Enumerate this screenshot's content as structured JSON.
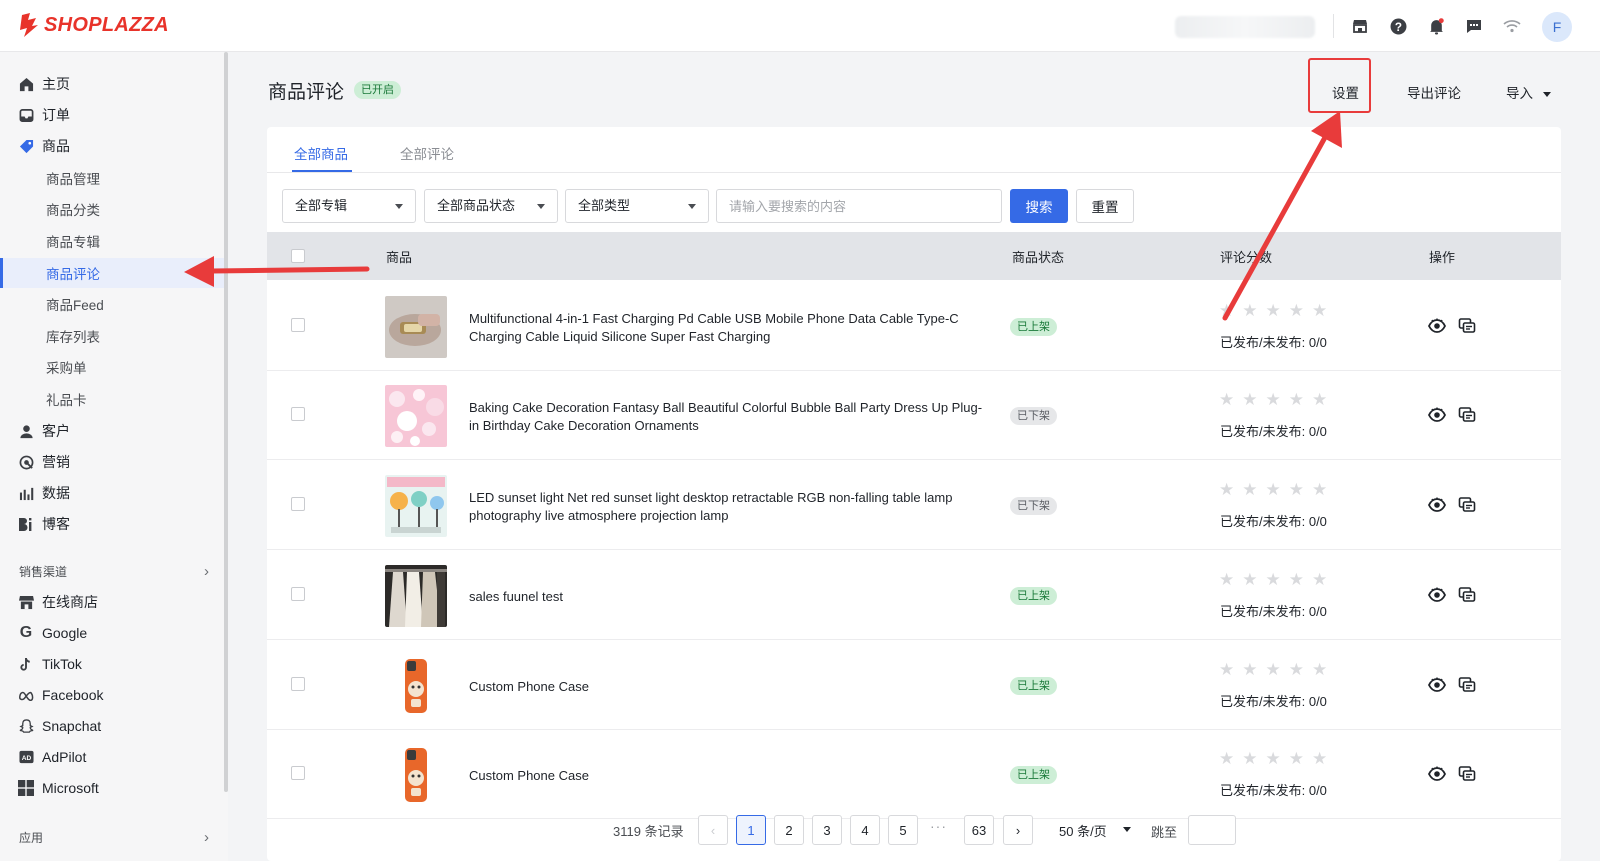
{
  "app": {
    "brand": "SHOPLAZZA",
    "user_initial": "F",
    "accent_color": "#356ae6",
    "annotation_color": "#e83b3b"
  },
  "topbar_icons": [
    "store-icon",
    "help-icon",
    "bell-icon",
    "message-icon",
    "wifi-icon"
  ],
  "sidebar": {
    "items": [
      {
        "label": "主页",
        "icon": "home-icon"
      },
      {
        "label": "订单",
        "icon": "inbox-icon"
      },
      {
        "label": "商品",
        "icon": "tag-icon"
      }
    ],
    "sub_items": [
      {
        "label": "商品管理"
      },
      {
        "label": "商品分类"
      },
      {
        "label": "商品专辑"
      },
      {
        "label": "商品评论",
        "active": true
      },
      {
        "label": "商品Feed"
      },
      {
        "label": "库存列表"
      },
      {
        "label": "采购单"
      },
      {
        "label": "礼品卡"
      }
    ],
    "items_after": [
      {
        "label": "客户",
        "icon": "user-icon"
      },
      {
        "label": "营销",
        "icon": "marketing-icon"
      },
      {
        "label": "数据",
        "icon": "chart-icon"
      },
      {
        "label": "博客",
        "icon": "blog-icon"
      }
    ],
    "sales_channels_title": "销售渠道",
    "channels": [
      {
        "label": "在线商店",
        "icon": "store-icon"
      },
      {
        "label": "Google",
        "icon": "google-icon"
      },
      {
        "label": "TikTok",
        "icon": "tiktok-icon"
      },
      {
        "label": "Facebook",
        "icon": "meta-icon"
      },
      {
        "label": "Snapchat",
        "icon": "snapchat-icon"
      },
      {
        "label": "AdPilot",
        "icon": "adpilot-icon"
      },
      {
        "label": "Microsoft",
        "icon": "microsoft-icon"
      }
    ],
    "apps_title": "应用"
  },
  "header": {
    "title": "商品评论",
    "badge": "已开启",
    "settings": "设置",
    "export": "导出评论",
    "import": "导入"
  },
  "tabs": [
    {
      "label": "全部商品",
      "active": true
    },
    {
      "label": "全部评论",
      "active": false
    }
  ],
  "filters": {
    "album": "全部专辑",
    "status": "全部商品状态",
    "type": "全部类型",
    "search_placeholder": "请输入要搜索的内容",
    "search_button": "搜索",
    "reset_button": "重置"
  },
  "table": {
    "columns": [
      "商品",
      "商品状态",
      "评论分数",
      "操作"
    ],
    "rows": [
      {
        "name": "Multifunctional 4-in-1 Fast Charging Pd Cable USB Mobile Phone Data Cable Type-C Charging Cable Liquid Silicone Super Fast Charging",
        "status": "已上架",
        "status_on": true,
        "published": "已发布/未发布: 0/0",
        "thumb": "cable"
      },
      {
        "name": "Baking Cake Decoration Fantasy Ball Beautiful Colorful Bubble Ball Party Dress Up Plug-in Birthday Cake Decoration Ornaments",
        "status": "已下架",
        "status_on": false,
        "published": "已发布/未发布: 0/0",
        "thumb": "pearls"
      },
      {
        "name": "LED sunset light Net red sunset light desktop retractable RGB non-falling table lamp photography live atmosphere projection lamp",
        "status": "已下架",
        "status_on": false,
        "published": "已发布/未发布: 0/0",
        "thumb": "lamp"
      },
      {
        "name": "sales fuunel test",
        "status": "已上架",
        "status_on": true,
        "published": "已发布/未发布: 0/0",
        "thumb": "clothes"
      },
      {
        "name": "Custom Phone Case",
        "status": "已上架",
        "status_on": true,
        "published": "已发布/未发布: 0/0",
        "thumb": "phonecase"
      },
      {
        "name": "Custom Phone Case",
        "status": "已上架",
        "status_on": true,
        "published": "已发布/未发布: 0/0",
        "thumb": "phonecase"
      }
    ]
  },
  "pagination": {
    "total": "3119 条记录",
    "pages": [
      "1",
      "2",
      "3",
      "4",
      "5"
    ],
    "current": "1",
    "ellipsis": "···",
    "last": "63",
    "page_size": "50 条/页",
    "jump_label": "跳至"
  }
}
